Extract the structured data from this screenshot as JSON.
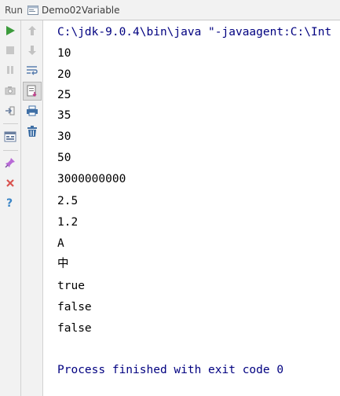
{
  "header": {
    "run_label": "Run",
    "tab_title": "Demo02Variable"
  },
  "toolbar": {
    "left_icons": [
      "run-icon",
      "stop-icon",
      "pause-icon",
      "camera-icon",
      "login-icon",
      "layout-icon",
      "pin-icon",
      "close-icon",
      "help-icon"
    ],
    "mid_icons": [
      "up-arrow-icon",
      "down-arrow-icon",
      "soft-wrap-icon",
      "scroll-to-end-icon",
      "print-icon",
      "trash-icon"
    ]
  },
  "console": {
    "command": "C:\\jdk-9.0.4\\bin\\java \"-javaagent:C:\\Int",
    "output": [
      "10",
      "20",
      "25",
      "35",
      "30",
      "50",
      "3000000000",
      "2.5",
      "1.2",
      "A",
      "中",
      "true",
      "false",
      "false"
    ],
    "exit_message": "Process finished with exit code 0"
  },
  "colors": {
    "run_green": "#3c9b3c",
    "stop_red": "#d9534f",
    "console_blue": "#000080",
    "toolbar_bg": "#f2f2f2"
  }
}
